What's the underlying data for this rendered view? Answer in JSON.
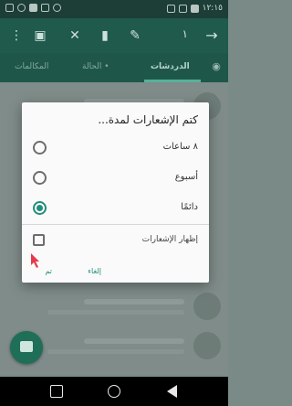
{
  "status_bar": {
    "time": "١٢:١٥"
  },
  "toolbar": {
    "selected_count": "١",
    "icons": [
      "archive-icon",
      "mute-icon",
      "delete-icon",
      "pin-icon",
      "more-icon"
    ]
  },
  "tabs": {
    "chats": "الدردشات",
    "status": "الحالة •",
    "calls": "المكالمات"
  },
  "dialog": {
    "title": "كتم الإشعارات لمدة...",
    "options": [
      {
        "label": "٨ ساعات",
        "checked": false
      },
      {
        "label": "أسبوع",
        "checked": false
      },
      {
        "label": "دائمًا",
        "checked": true
      }
    ],
    "show_notifications": "إظهار الإشعارات",
    "cancel": "إلغاء",
    "ok": "تم"
  },
  "colors": {
    "accent": "#1f8f79",
    "toolbar": "#1f5a4d",
    "annotation_arrow": "#e8394a"
  }
}
